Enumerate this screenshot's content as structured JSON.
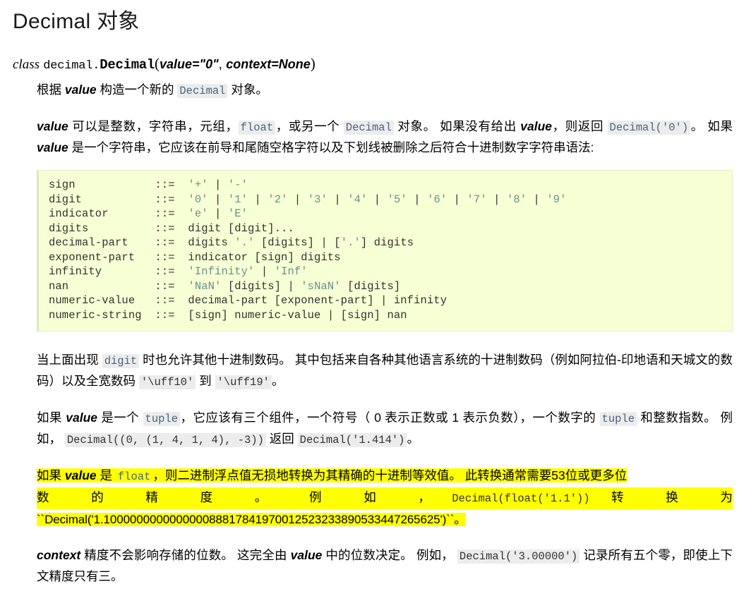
{
  "document": {
    "title": "Decimal 对象"
  },
  "signature": {
    "keyword": "class",
    "module": "decimal.",
    "class_name": "Decimal",
    "open_paren": "(",
    "param1": "value=\"0\"",
    "comma": ", ",
    "param2": "context=None",
    "close_paren": ")"
  },
  "paragraphs": {
    "intro": {
      "part1": "根据 ",
      "em1": "value",
      "part2": " 构造一个新的 ",
      "lit1": "Decimal",
      "part3": " 对象。"
    },
    "value_desc": {
      "em1": "value",
      "part1": " 可以是整数，字符串，元组，",
      "lit1": "float",
      "part2": "，或另一个 ",
      "lit2": "Decimal",
      "part3": " 对象。 如果没有给出 ",
      "em2": "value",
      "part4": "，则返回 ",
      "lit3": "Decimal('0')",
      "part5": "。 如果 ",
      "em3": "value",
      "part6": " 是一个字符串，它应该在前导和尾随空格字符以及下划线被删除之后符合十进制数字字符串语法:"
    },
    "digit_note": {
      "part1": "当上面出现 ",
      "lit1": "digit",
      "part2": " 时也允许其他十进制数码。 其中包括来自各种其他语言系统的十进制数码（例如阿拉伯-印地语和天城文的数码）以及全宽数码 ",
      "lit2": "'\\uff10'",
      "part3": " 到 ",
      "lit3": "'\\uff19'",
      "part4": "。"
    },
    "tuple_note": {
      "part1": "如果 ",
      "em1": "value",
      "part2": " 是一个 ",
      "lit1": "tuple",
      "part3": "，它应该有三个组件，一个符号（ 0 表示正数或 1 表示负数），一个数字的 ",
      "lit2": "tuple",
      "part4": " 和整数指数。 例如， ",
      "lit3": "Decimal((0, (1, 4, 1, 4), -3))",
      "part5": " 返回 ",
      "lit4": "Decimal('1.414')",
      "part6": "。"
    },
    "float_note": {
      "line1_part1": "如果 ",
      "line1_em": "value",
      "line1_part2": " 是 ",
      "line1_lit": "float",
      "line1_part3": "，则二进制浮点值无损地转换为其精确的十进制等效值。 此转换通常需要53位或更多位",
      "line2_left": "数 的 精 度 。 例 如 ，",
      "line2_lit": "Decimal(float('1.1'))",
      "line2_right": "转 换 为",
      "line3": "``Decimal('1.100000000000000088817841970012523233890533447265625')``。"
    },
    "context_note": {
      "em1": "context",
      "part1": " 精度不会影响存储的位数。 这完全由 ",
      "em2": "value",
      "part2": " 中的位数决定。 例如， ",
      "lit1": "Decimal('3.00000')",
      "part3": " 记录所有五个零，即使上下文精度只有三。"
    }
  },
  "grammar_block": {
    "lines": [
      {
        "name": "sign",
        "op": "::=",
        "def": "'+' | '-'"
      },
      {
        "name": "digit",
        "op": "::=",
        "def": "'0' | '1' | '2' | '3' | '4' | '5' | '6' | '7' | '8' | '9'"
      },
      {
        "name": "indicator",
        "op": "::=",
        "def": "'e' | 'E'"
      },
      {
        "name": "digits",
        "op": "::=",
        "def": "digit [digit]..."
      },
      {
        "name": "decimal-part",
        "op": "::=",
        "def": "digits '.' [digits] | ['.'] digits"
      },
      {
        "name": "exponent-part",
        "op": "::=",
        "def": "indicator [sign] digits"
      },
      {
        "name": "infinity",
        "op": "::=",
        "def": "'Infinity' | 'Inf'"
      },
      {
        "name": "nan",
        "op": "::=",
        "def": "'NaN' [digits] | 'sNaN' [digits]"
      },
      {
        "name": "numeric-value",
        "op": "::=",
        "def": "decimal-part [exponent-part] | infinity"
      },
      {
        "name": "numeric-string",
        "op": "::=",
        "def": "[sign] numeric-value | [sign] nan"
      }
    ]
  },
  "colors": {
    "code_background": "#f7ffd4",
    "code_border": "#dfe8bb",
    "inline_literal_background": "#ececec",
    "inline_literal_text": "#46667f",
    "string_literal_text": "#6a8f8f",
    "highlight": "#ffff00"
  }
}
